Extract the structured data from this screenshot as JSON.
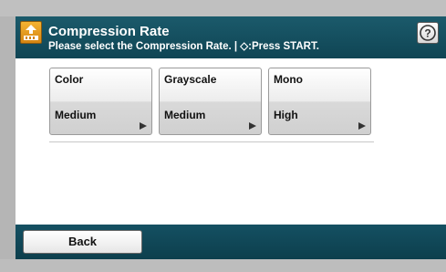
{
  "header": {
    "title": "Compression Rate",
    "subtitle": "Please select the Compression Rate. | ◇:Press START.",
    "help_label": "?"
  },
  "options": [
    {
      "label": "Color",
      "value": "Medium"
    },
    {
      "label": "Grayscale",
      "value": "Medium"
    },
    {
      "label": "Mono",
      "value": "High"
    }
  ],
  "footer": {
    "back_label": "Back"
  },
  "icons": {
    "header_icon": "scan-to-icon",
    "help_icon": "help-icon",
    "option_arrow": "triangle-right-icon"
  },
  "colors": {
    "header_bg": "#145062",
    "icon_accent": "#f0a324"
  }
}
